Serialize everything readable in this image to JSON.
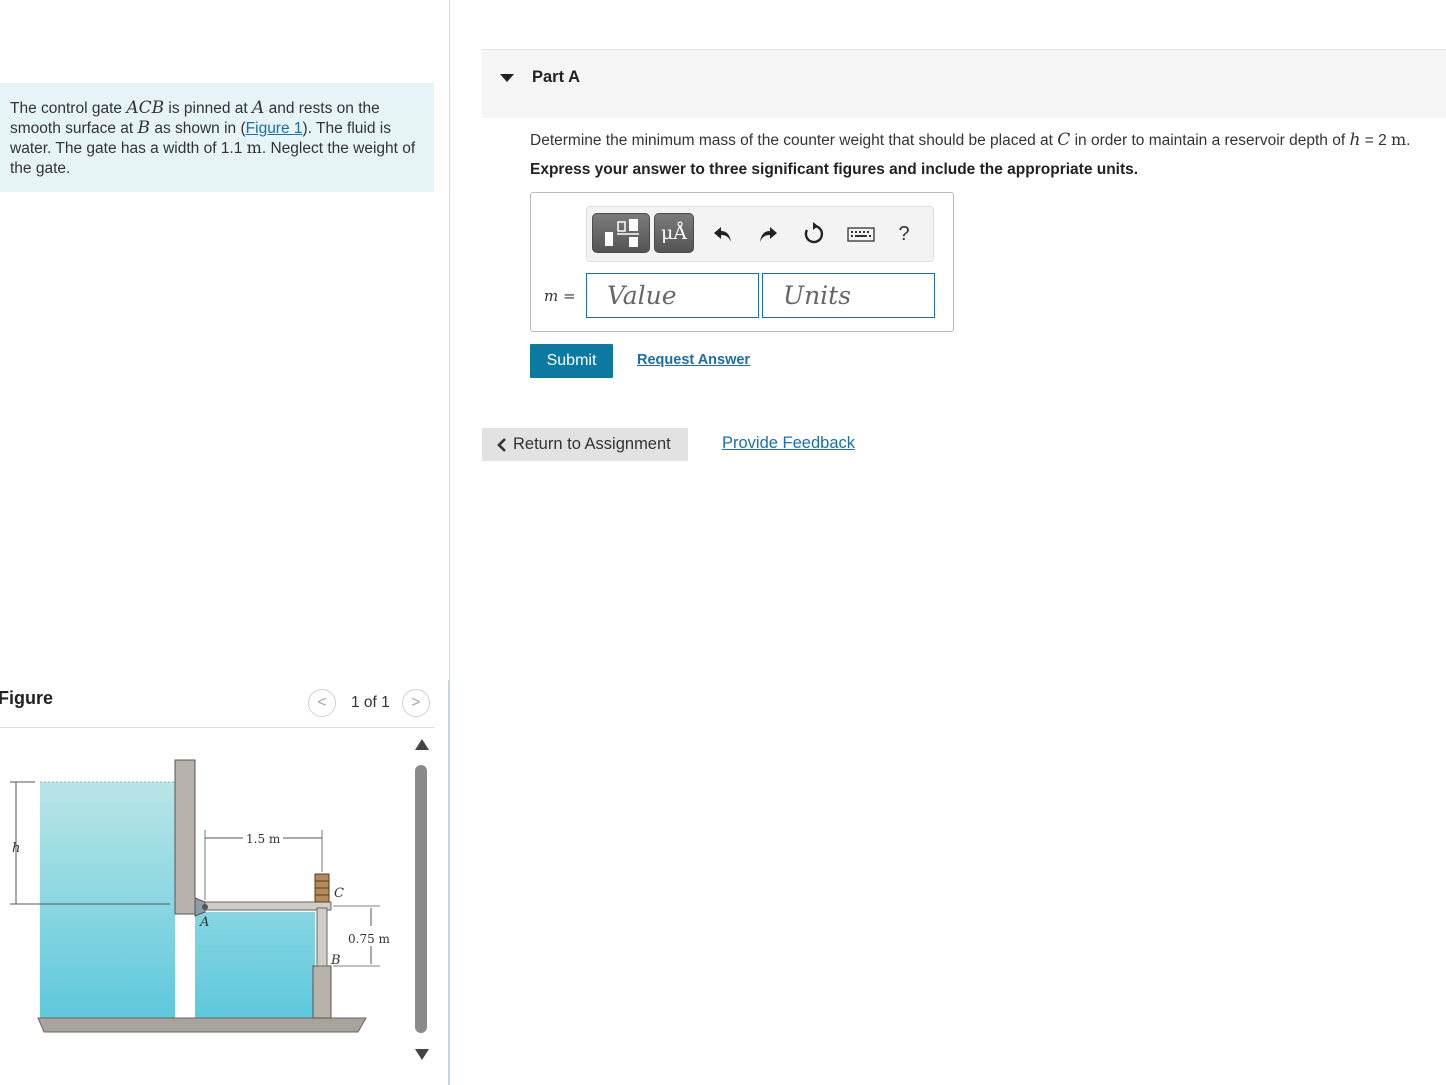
{
  "problem": {
    "t1": "The control gate ",
    "v_acb": "ACB",
    "t2": " is pinned at ",
    "v_a": "A",
    "t3": " and rests on the smooth surface at ",
    "v_b": "B",
    "t4": " as shown in (",
    "figure_link": "Figure 1",
    "t5": "). The fluid is water. The gate has a width of 1.1 ",
    "unit_m": "m",
    "t6": ". Neglect the weight of the gate."
  },
  "figure_panel": {
    "title": "Figure",
    "counter": "1 of 1",
    "prev_glyph": "<",
    "next_glyph": ">",
    "labels": {
      "h": "h",
      "dim_horizontal": "1.5 m",
      "c": "C",
      "a": "A",
      "dim_vertical": "0.75 m",
      "b": "B"
    }
  },
  "part": {
    "title": "Part A",
    "q1": "Determine the minimum mass of the counter weight that should be placed at ",
    "v_c": "C",
    "q2": " in order to maintain a reservoir depth of ",
    "v_h": "h",
    "q3": " = 2 ",
    "unit_m": "m",
    "q4": ".",
    "instruction": "Express your answer to three significant figures and include the appropriate units."
  },
  "answer": {
    "variable": "m",
    "equals": " =",
    "value_placeholder": "Value",
    "units_placeholder": "Units",
    "toolbar": {
      "templates_icon": "templates-icon",
      "units_button": "μÅ",
      "undo_icon": "undo-icon",
      "redo_icon": "redo-icon",
      "reset_icon": "reset-icon",
      "keyboard_icon": "keyboard-icon",
      "help": "?"
    }
  },
  "actions": {
    "submit": "Submit",
    "request_answer": "Request Answer",
    "return": "Return to Assignment",
    "feedback": "Provide Feedback"
  },
  "colors": {
    "problem_bg": "#e6f4f5",
    "water_top": "#b9e5e6",
    "water_bottom": "#5cc8dc",
    "accent_blue": "#0c7aa0",
    "link_blue": "#1a6fa6"
  }
}
